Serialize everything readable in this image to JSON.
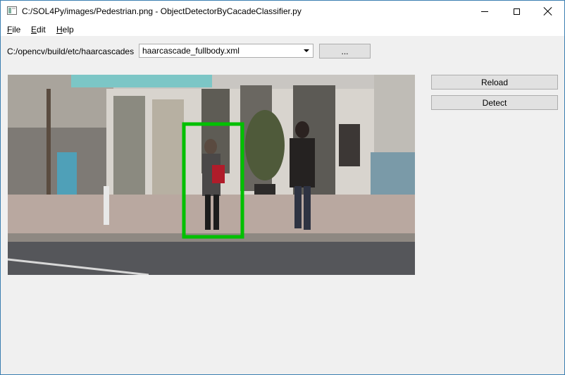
{
  "window": {
    "title": "C:/SOL4Py/images/Pedestrian.png - ObjectDetectorByCacadeClassifier.py",
    "controls": {
      "minimize": "minimize-icon",
      "maximize": "maximize-icon",
      "close": "close-icon"
    }
  },
  "menu": {
    "file": {
      "mnemonic": "F",
      "rest": "ile"
    },
    "edit": {
      "mnemonic": "E",
      "rest": "dit"
    },
    "help": {
      "mnemonic": "H",
      "rest": "elp"
    }
  },
  "toolbar": {
    "path_label": "C:/opencv/build/etc/haarcascades",
    "classifier_selected": "haarcascade_fullbody.xml",
    "browse_label": "..."
  },
  "actions": {
    "reload_label": "Reload",
    "detect_label": "Detect"
  },
  "image": {
    "content": "street scene with pedestrians",
    "detection_box_color": "#00c000"
  },
  "colors": {
    "window_border": "#3c7fb1",
    "background": "#f0f0f0",
    "button_face": "#e1e1e1"
  }
}
